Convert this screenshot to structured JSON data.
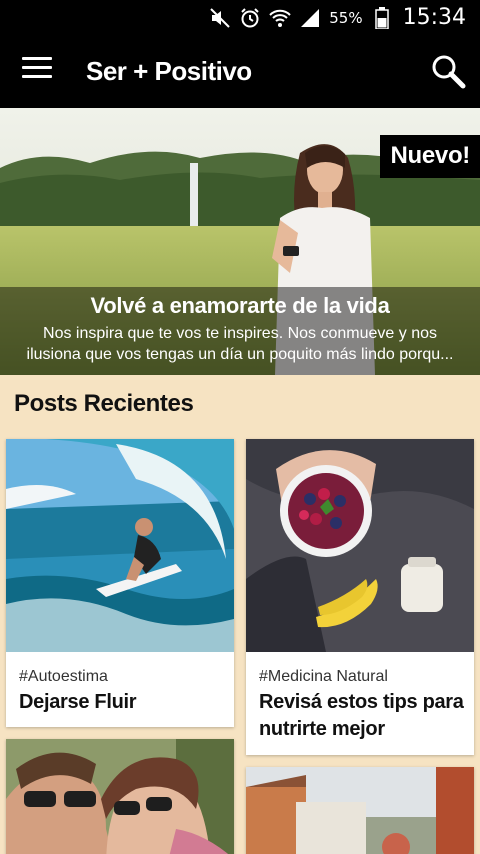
{
  "status_bar": {
    "battery_percent": "55%",
    "time": "15:34",
    "icons": [
      "mute-icon",
      "alarm-icon",
      "wifi-icon",
      "signal-icon",
      "battery-icon"
    ]
  },
  "app_bar": {
    "title": "Ser + Positivo",
    "menu_icon": "hamburger-menu-icon",
    "search_icon": "search-icon"
  },
  "featured": {
    "badge": "Nuevo!",
    "title": "Volvé a enamorarte de la vida",
    "description_line1": "Nos inspira que te vos te inspires. Nos conmueve y nos",
    "description_line2": "ilusiona que vos tengas un día un poquito más lindo porqu..."
  },
  "recent": {
    "heading": "Posts Recientes",
    "posts": [
      {
        "tag": "#Autoestima",
        "title": "Dejarse Fluir"
      },
      {
        "tag": "#Medicina Natural",
        "title": "Revisá estos tips para nutrirte mejor"
      }
    ]
  },
  "colors": {
    "background": "#f6e3c2",
    "bar": "#000000",
    "card": "#ffffff"
  }
}
